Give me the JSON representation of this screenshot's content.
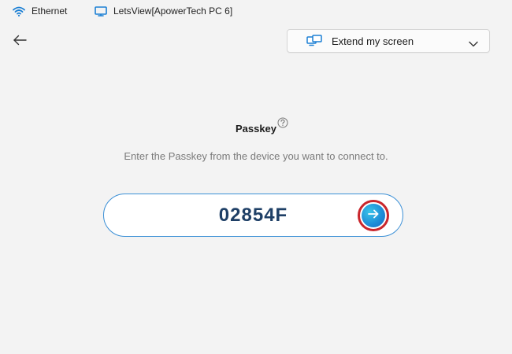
{
  "network": {
    "ethernet_label": "Ethernet",
    "device_label": "LetsView[ApowerTech PC 6]"
  },
  "mode_select": {
    "selected": "Extend my screen"
  },
  "passkey": {
    "title": "Passkey",
    "instruction": "Enter the Passkey from the device you want to connect to.",
    "value": "02854F"
  },
  "icons": {
    "wifi": "wifi-icon",
    "monitor": "monitor-icon",
    "back": "back-arrow-icon",
    "extend": "extend-screen-icon",
    "chevron": "chevron-down-icon",
    "help": "help-icon",
    "go": "arrow-right-icon"
  },
  "colors": {
    "accent": "#1e8fd8",
    "passkey_text": "#1e3f66",
    "highlight_ring": "#c9262c",
    "field_border": "#3a8fd6"
  }
}
